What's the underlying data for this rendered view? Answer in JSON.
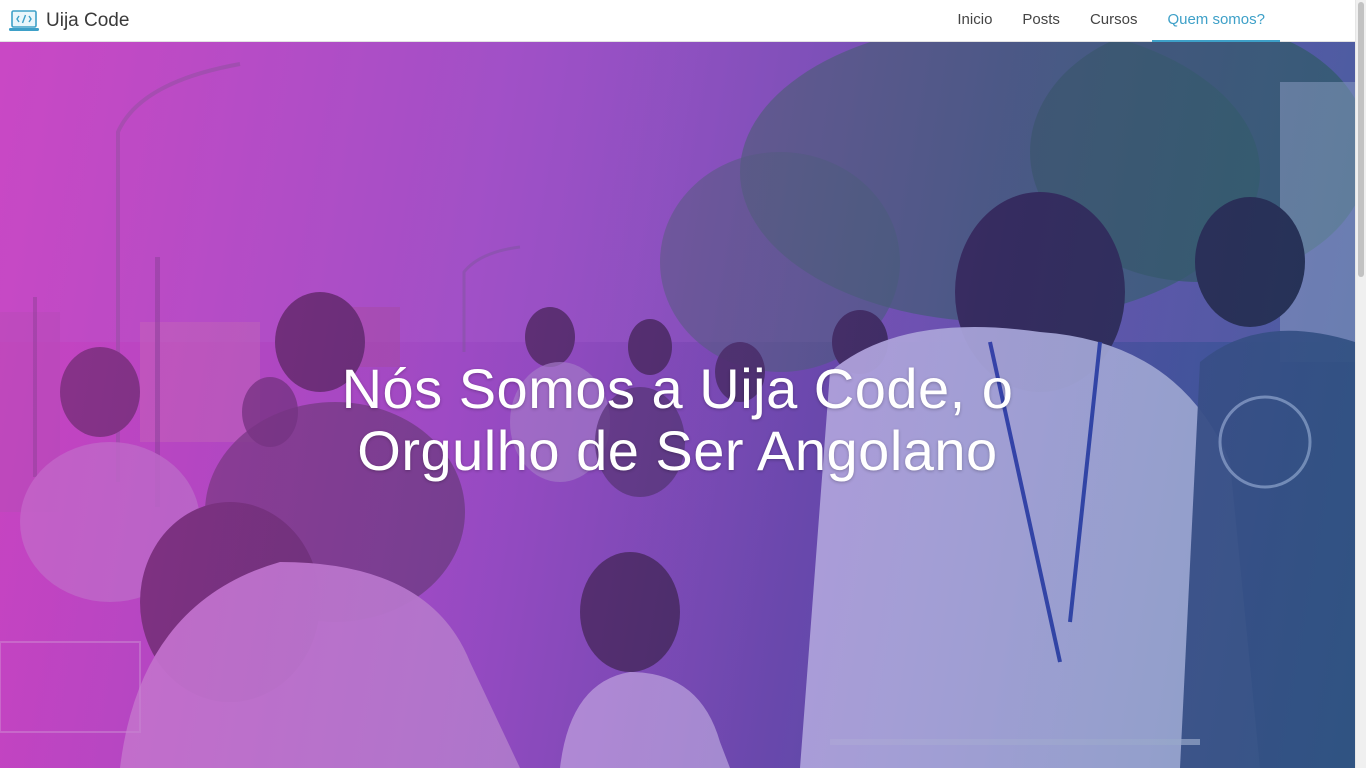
{
  "brand": {
    "name": "Uija Code",
    "icon": "laptop-code-icon"
  },
  "nav": {
    "items": [
      {
        "label": "Inicio",
        "active": false
      },
      {
        "label": "Posts",
        "active": false
      },
      {
        "label": "Cursos",
        "active": false
      },
      {
        "label": "Quem somos?",
        "active": true
      }
    ]
  },
  "hero": {
    "title": "Nós Somos a Uija Code, o Orgulho de Ser Angolano",
    "image": "group-of-young-people-with-bicycles-photo",
    "overlay_colors": [
      "#d63cc8",
      "#9646c8",
      "#4646aa",
      "#1e5a8c"
    ]
  },
  "colors": {
    "accent": "#3ea0c8",
    "nav_text": "#444444",
    "brand_text": "#3a3a3a"
  }
}
